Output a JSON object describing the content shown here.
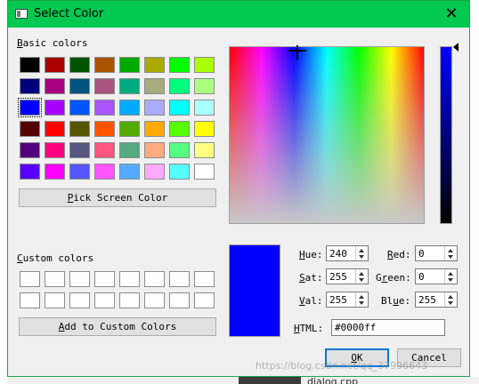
{
  "window": {
    "title": "Select Color",
    "close_symbol": "✕"
  },
  "basic_colors": {
    "label": "Basic colors",
    "accel": "B",
    "selected_index": 16,
    "colors": [
      "#000000",
      "#aa0000",
      "#005500",
      "#aa5500",
      "#00aa00",
      "#aaaa00",
      "#00ff00",
      "#aaff00",
      "#00007f",
      "#aa007f",
      "#00557f",
      "#aa557f",
      "#00aa7f",
      "#aaaa7f",
      "#00ff7f",
      "#aaff7f",
      "#0000ff",
      "#aa00ff",
      "#0055ff",
      "#aa55ff",
      "#00aaff",
      "#aaaaff",
      "#00ffff",
      "#aaffff",
      "#550000",
      "#ff0000",
      "#555500",
      "#ff5500",
      "#55aa00",
      "#ffaa00",
      "#55ff00",
      "#ffff00",
      "#55007f",
      "#ff007f",
      "#55557f",
      "#ff557f",
      "#55aa7f",
      "#ffaa7f",
      "#55ff7f",
      "#ffff7f",
      "#5500ff",
      "#ff00ff",
      "#5555ff",
      "#ff55ff",
      "#55aaff",
      "#ffaaff",
      "#55ffff",
      "#ffffff"
    ]
  },
  "pick_screen_button": {
    "accel": "P",
    "label": "ick Screen Color"
  },
  "custom_colors": {
    "label": "Custom colors",
    "accel": "C",
    "count": 16
  },
  "add_custom_button": {
    "accel": "A",
    "label": "dd to Custom Colors"
  },
  "current_color": "#0000ff",
  "fields": {
    "hue": {
      "accel": "H",
      "label": "ue:",
      "value": "240"
    },
    "sat": {
      "accel": "S",
      "label": "at:",
      "value": "255"
    },
    "val": {
      "accel": "V",
      "label": "al:",
      "value": "255"
    },
    "red": {
      "accel": "R",
      "label": "ed:",
      "value": "0"
    },
    "green": {
      "prefix": "G",
      "accel": "r",
      "label": "een:",
      "value": "0"
    },
    "blue": {
      "prefix": "Bl",
      "accel": "u",
      "label": "e:",
      "value": "255"
    },
    "html": {
      "accel": "H",
      "label": "TML:",
      "value": "#0000ff"
    }
  },
  "ok_button": {
    "accel": "O",
    "label": "K"
  },
  "cancel_button": {
    "label": "Cancel"
  },
  "background": {
    "file_label": "dialog.cpp",
    "watermark": "https://blog.csdn.net/qq_37996643"
  }
}
